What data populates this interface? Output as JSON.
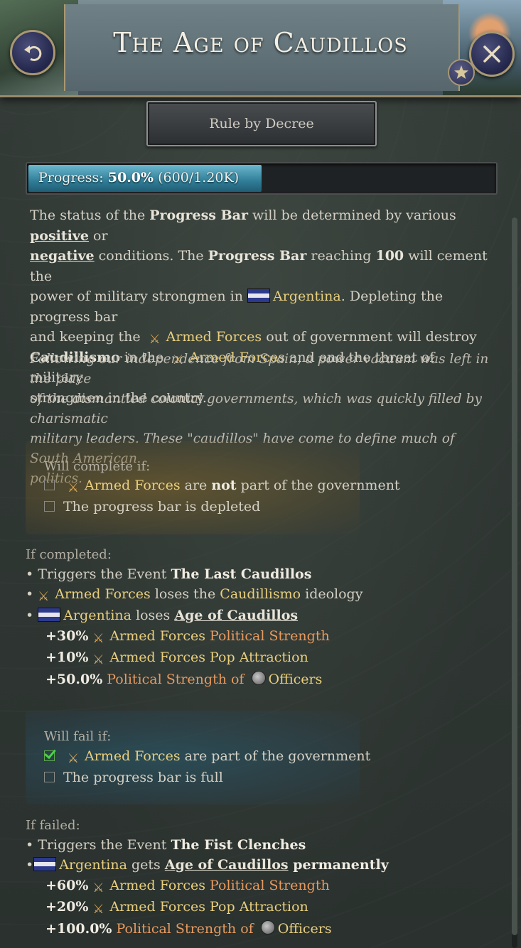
{
  "header": {
    "title": "The Age of Caudillos",
    "back_icon": "back-arrow-icon",
    "close_icon": "close-icon",
    "star_icon": "star-icon"
  },
  "decree_button": {
    "label": "Rule by Decree"
  },
  "progress": {
    "label": "Progress:",
    "percent": "50.0%",
    "detail": "(600/1.20K)",
    "fraction": 0.5
  },
  "description": {
    "t1": "The status of the ",
    "progress_bar_1": "Progress Bar",
    "t2": " will be determined by various ",
    "positive": "positive",
    "t3": " or",
    "negative": "negative",
    "t4": " conditions. The ",
    "progress_bar_2": "Progress Bar",
    "t5": " reaching ",
    "hundred": "100",
    "t6": " will cement the",
    "t7": "power of military strongmen in ",
    "country": "Argentina",
    "t8": ". Depleting the progress bar",
    "t9": "and keeping the ",
    "armed_forces": "Armed Forces",
    "t10": " out of government will destroy",
    "caudillismo": "Caudillismo",
    "t11": " in the ",
    "t12": " and end the threat of military",
    "t13": "strongmen in the country."
  },
  "flavor": {
    "l1": "Following our independence from Spain, a power vacuum was left in the place",
    "l2": "of the dismantled colonial governments, which was quickly filled by charismatic",
    "l3": "military leaders. These \"caudillos\" have come to define much of South American",
    "l4": "politics."
  },
  "complete_conditions": {
    "title": "Will complete if:",
    "c1_group": "Armed Forces",
    "c1_a": " are ",
    "c1_not": "not",
    "c1_b": " part of the government",
    "c2": "The progress bar is depleted"
  },
  "if_completed": {
    "title": "If completed:",
    "l1_a": "• Triggers the Event ",
    "l1_event": "The Last Caudillos",
    "l2_bullet": "•",
    "l2_group": "Armed Forces",
    "l2_a": " loses the ",
    "l2_ideology": "Caudillismo",
    "l2_b": " ideology",
    "l3_bullet": "•",
    "l3_country": "Argentina",
    "l3_a": " loses ",
    "l3_modifier": "Age of Caudillos",
    "m1_value": "+30%",
    "m1_group": "Armed Forces",
    "m1_stat": " Political Strength",
    "m2_value": "+10%",
    "m2_group": "Armed Forces",
    "m2_stat": " Pop Attraction",
    "m3_value": "+50.0%",
    "m3_stat": " Political Strength",
    "m3_of": " of ",
    "m3_pop": "Officers"
  },
  "fail_conditions": {
    "title": "Will fail if:",
    "c1_group": "Armed Forces",
    "c1_a": " are part of the government",
    "c2": "The progress bar is full"
  },
  "if_failed": {
    "title": "If failed:",
    "l1_a": "• Triggers the Event ",
    "l1_event": "The Fist Clenches",
    "l2_bullet": "•",
    "l2_country": "Argentina",
    "l2_a": " gets ",
    "l2_modifier": "Age of Caudillos",
    "l2_b": " permanently",
    "m1_value": "+60%",
    "m1_group": "Armed Forces",
    "m1_stat": " Political Strength",
    "m2_value": "+20%",
    "m2_group": "Armed Forces",
    "m2_stat": " Pop Attraction",
    "m3_value": "+100.0%",
    "m3_stat": " Political Strength",
    "m3_of": " of ",
    "m3_pop": "Officers"
  },
  "colors": {
    "gold": "#e9cf7d",
    "orange": "#e89a5f",
    "progress": "#4aa3bf"
  }
}
